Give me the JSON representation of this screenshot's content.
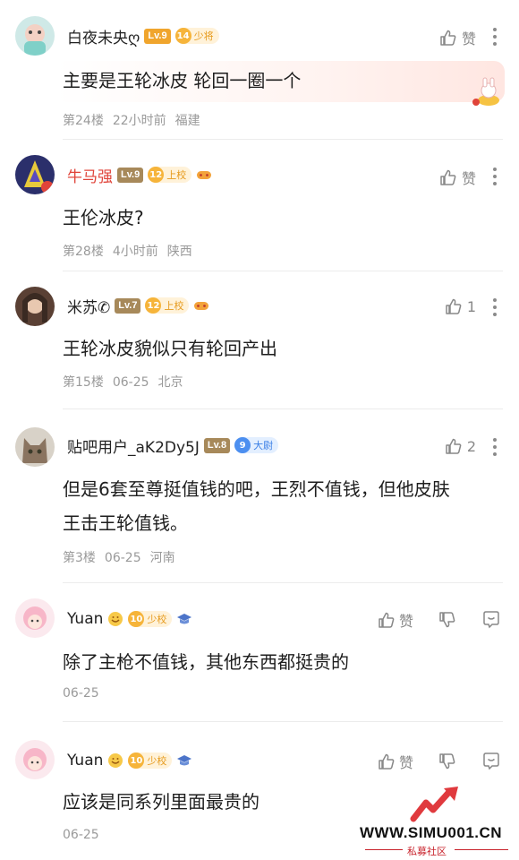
{
  "posts": [
    {
      "username": "白夜未央ღ",
      "level": "Lv.9",
      "badge_num": "14",
      "badge_text": "少将",
      "like_label": "赞",
      "text": "主要是王轮冰皮 轮回一圈一个",
      "floor": "第24楼",
      "time": "22小时前",
      "location": "福建"
    },
    {
      "username": "牛马强",
      "level": "Lv.9",
      "badge_num": "12",
      "badge_text": "上校",
      "like_label": "赞",
      "text": "王伦冰皮?",
      "floor": "第28楼",
      "time": "4小时前",
      "location": "陕西"
    },
    {
      "username": "米苏✆",
      "level": "Lv.7",
      "badge_num": "12",
      "badge_text": "上校",
      "like_count": "1",
      "text": "王轮冰皮貌似只有轮回产出",
      "floor": "第15楼",
      "time": "06-25",
      "location": "北京"
    },
    {
      "username": "贴吧用户_aK2Dy5J",
      "level": "Lv.8",
      "badge_num": "9",
      "badge_text": "大尉",
      "like_count": "2",
      "text_line1": "但是6套至尊挺值钱的吧，王烈不值钱，但他皮肤",
      "text_line2": "王击王轮值钱。",
      "floor": "第3楼",
      "time": "06-25",
      "location": "河南"
    }
  ],
  "replies": [
    {
      "username": "Yuan",
      "badge_num": "10",
      "badge_text": "少校",
      "like_label": "赞",
      "text": "除了主枪不值钱，其他东西都挺贵的",
      "time": "06-25"
    },
    {
      "username": "Yuan",
      "badge_num": "10",
      "badge_text": "少校",
      "like_label": "赞",
      "text": "应该是同系列里面最贵的",
      "time": "06-25"
    }
  ],
  "watermark": {
    "url": "WWW.SIMU001.CN",
    "sub": "私募社区"
  },
  "colors": {
    "accent_red": "#e0443a",
    "level_badge": "#a7895a",
    "gold_badge": "#f0a52d",
    "blue_badge": "#4c8ff0"
  }
}
